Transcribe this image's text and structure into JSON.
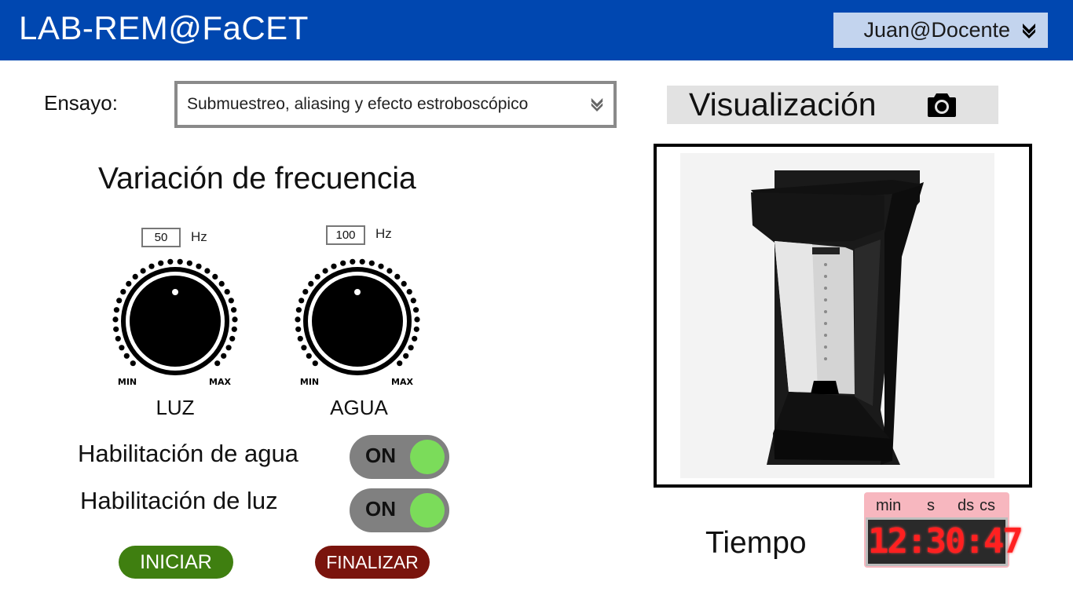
{
  "header": {
    "app_title": "LAB-REM@FaCET",
    "user": "Juan@Docente",
    "header_color": "#0047b0"
  },
  "experiment": {
    "label": "Ensayo:",
    "selected": "Submuestreo, aliasing y efecto estroboscópico"
  },
  "frequency": {
    "title": "Variación de frecuencia",
    "knobs": [
      {
        "name": "LUZ",
        "value": "50",
        "unit": "Hz",
        "min_label": "MIN",
        "max_label": "MAX"
      },
      {
        "name": "AGUA",
        "value": "100",
        "unit": "Hz",
        "min_label": "MIN",
        "max_label": "MAX"
      }
    ]
  },
  "toggles": [
    {
      "label": "Habilitación de agua",
      "state": "ON"
    },
    {
      "label": "Habilitación de luz",
      "state": "ON"
    }
  ],
  "actions": {
    "start": "INICIAR",
    "stop": "FINALIZAR"
  },
  "visualization": {
    "title": "Visualización",
    "icon": "camera-icon"
  },
  "timer": {
    "label": "Tiempo",
    "units": [
      "min",
      "s",
      "ds",
      "cs"
    ],
    "display": "12:30:47"
  },
  "colors": {
    "toggle_on": "#7bdc5a",
    "start_button": "#3f7f10",
    "stop_button": "#7a140d",
    "timer_digits": "#ff2020"
  }
}
